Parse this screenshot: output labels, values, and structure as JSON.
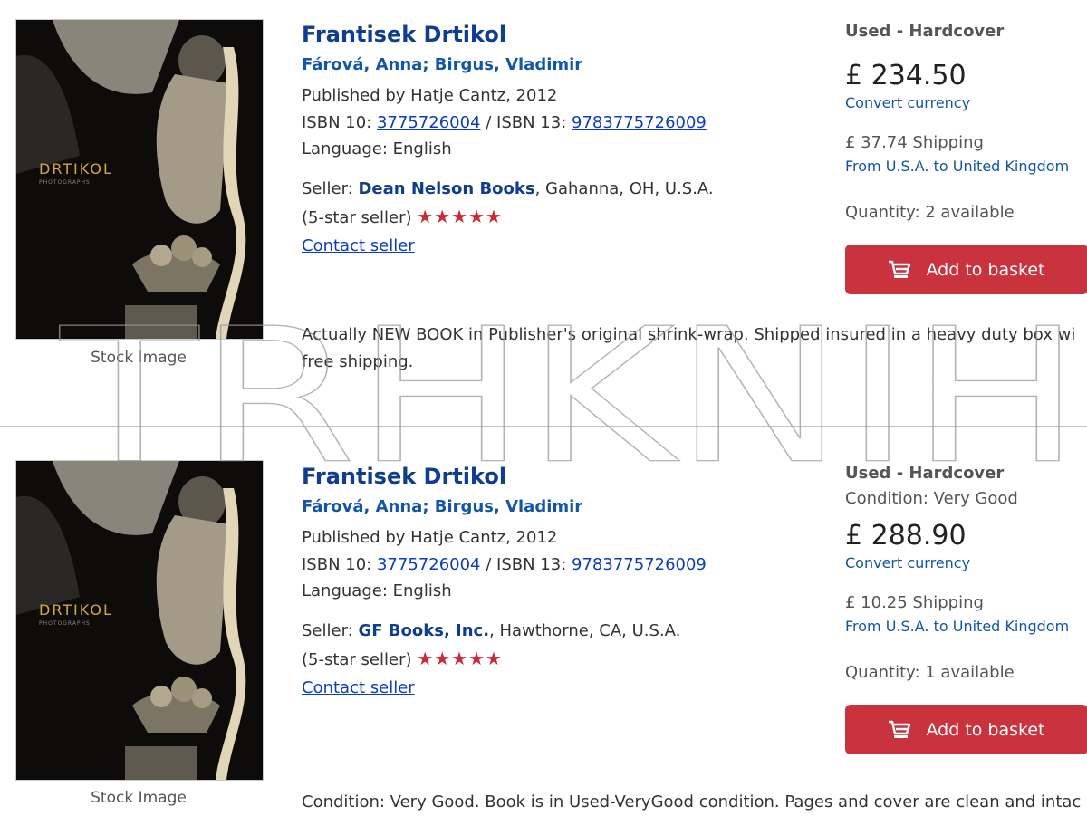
{
  "listings": [
    {
      "title": "Frantisek Drtikol",
      "authors": "Fárová, Anna; Birgus, Vladimir",
      "published": "Published by Hatje Cantz, 2012",
      "isbn10_label": "ISBN 10:",
      "isbn10": "3775726004",
      "isbn_sep": " / ISBN 13:",
      "isbn13": "9783775726009",
      "language": "Language: English",
      "seller_prefix": "Seller:",
      "seller_name": "Dean Nelson Books",
      "seller_location": ", Gahanna, OH, U.S.A.",
      "seller_rating_text": "(5-star seller)",
      "seller_stars": 5,
      "contact": "Contact seller",
      "stock_label": "Stock Image",
      "cover_text": "DRTIKOL",
      "cover_subtext": "PHOTOGRAPHS",
      "binding": "Used - Hardcover",
      "price": "£ 234.50",
      "convert": "Convert currency",
      "shipping": "£ 37.74 Shipping",
      "ship_route": "From U.S.A. to United Kingdom",
      "quantity": "Quantity: 2 available",
      "add_button": "Add to basket",
      "description_line1": "Actually NEW BOOK in Publisher's original shrink-wrap. Shipped insured in a heavy duty box wi",
      "description_line2": "free shipping."
    },
    {
      "title": "Frantisek Drtikol",
      "authors": "Fárová, Anna; Birgus, Vladimir",
      "published": "Published by Hatje Cantz, 2012",
      "isbn10_label": "ISBN 10:",
      "isbn10": "3775726004",
      "isbn_sep": " / ISBN 13:",
      "isbn13": "9783775726009",
      "language": "Language: English",
      "seller_prefix": "Seller:",
      "seller_name": "GF Books, Inc.",
      "seller_location": ", Hawthorne, CA, U.S.A.",
      "seller_rating_text": "(5-star seller)",
      "seller_stars": 5,
      "contact": "Contact seller",
      "stock_label": "Stock Image",
      "cover_text": "DRTIKOL",
      "cover_subtext": "PHOTOGRAPHS",
      "binding": "Used - Hardcover",
      "condition": "Condition: Very Good",
      "price": "£ 288.90",
      "convert": "Convert currency",
      "shipping": "£ 10.25 Shipping",
      "ship_route": "From U.S.A. to United Kingdom",
      "quantity": "Quantity: 1 available",
      "add_button": "Add to basket",
      "description_line1": "Condition: Very Good. Book is in Used-VeryGood condition. Pages and cover are clean and intac"
    }
  ],
  "watermark_text": "TRHKNIH",
  "colors": {
    "title": "#0f3d8f",
    "link": "#0b3cc1",
    "star": "#c92a35",
    "button": "#c9333d",
    "divider": "#b9c7c4"
  },
  "icons": {
    "star": "star-icon",
    "cart": "cart-icon"
  }
}
